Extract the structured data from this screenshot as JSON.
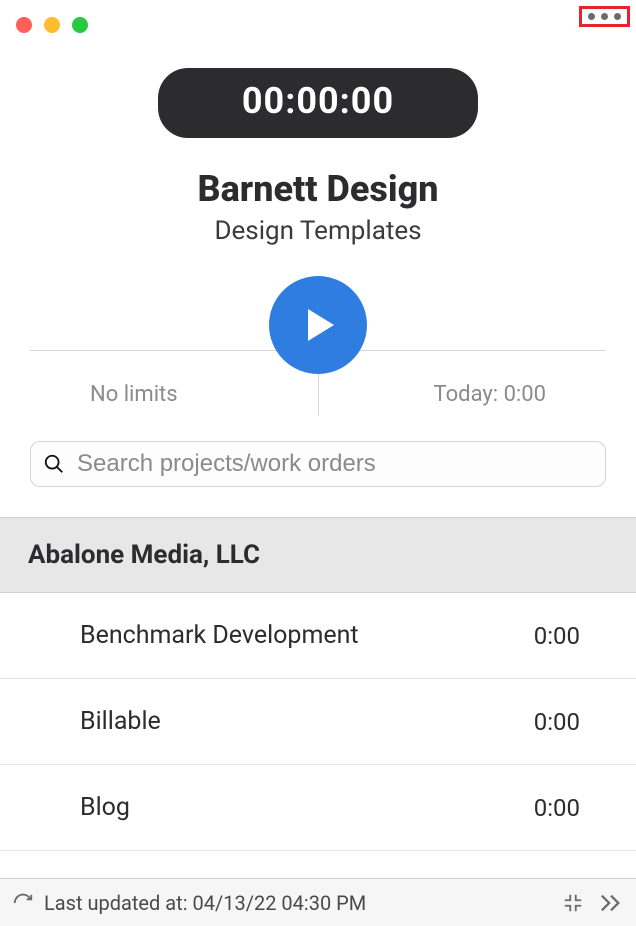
{
  "timer": {
    "display": "00:00:00"
  },
  "header": {
    "title": "Barnett Design",
    "subtitle": "Design Templates"
  },
  "stats": {
    "limits": "No limits",
    "today": "Today: 0:00"
  },
  "search": {
    "placeholder": "Search projects/work orders"
  },
  "section": {
    "title": "Abalone Media, LLC"
  },
  "items": [
    {
      "label": "Benchmark Development",
      "time": "0:00"
    },
    {
      "label": "Billable",
      "time": "0:00"
    },
    {
      "label": "Blog",
      "time": "0:00"
    }
  ],
  "footer": {
    "updated": "Last updated at: 04/13/22 04:30 PM"
  }
}
